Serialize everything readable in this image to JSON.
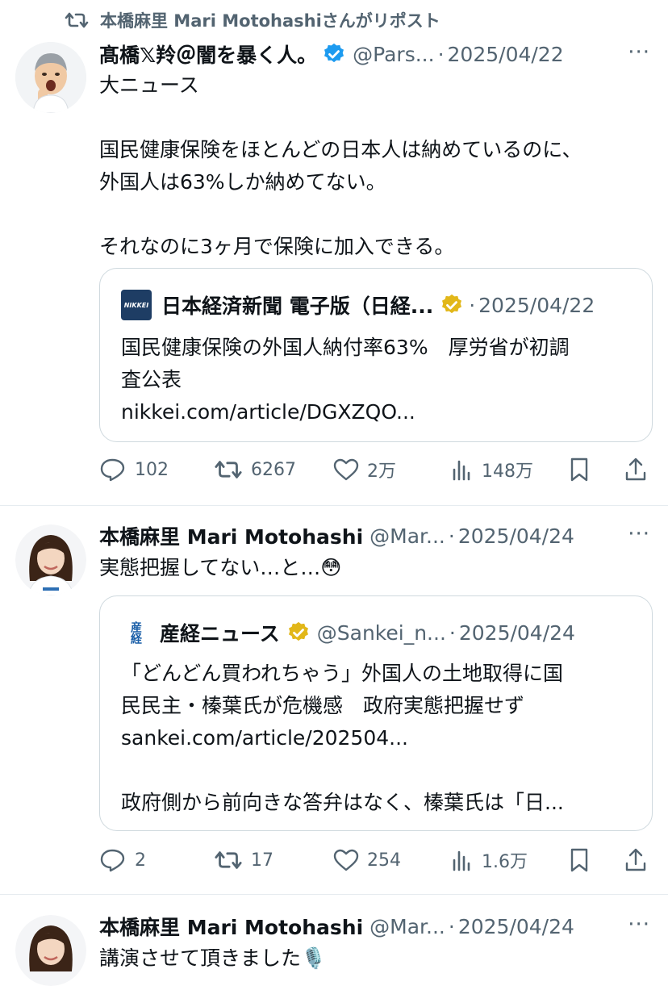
{
  "repost_banner": {
    "text": "本橋麻里 Mari Motohashiさんがリポスト"
  },
  "tweets": [
    {
      "name": "髙橋𝕏羚＠闇を暴く人。",
      "handle": "@Pars...",
      "sep": "·",
      "date": "2025/04/22",
      "more": "···",
      "body": "大ニュース\n\n国民健康保険をほとんどの日本人は納めているのに、\n外国人は63%しか納めてない。\n\nそれなのに3ヶ月で保険に加入できる。",
      "quote": {
        "logo_text": "NIKKEI",
        "name": "日本経済新聞 電子版（日経...",
        "sep": "·",
        "date": "2025/04/22",
        "text": "国民健康保険の外国人納付率63%　厚労省が初調\n査公表\nnikkei.com/article/DGXZQO..."
      },
      "actions": {
        "reply": "102",
        "repost": "6267",
        "like": "2万",
        "views": "148万"
      }
    },
    {
      "name": "本橋麻里 Mari Motohashi",
      "handle": "@Mar...",
      "sep": "·",
      "date": "2025/04/24",
      "more": "···",
      "body": "実態把握してない…と…😳",
      "quote": {
        "logo_text": "産経",
        "name": "産経ニュース",
        "handle": "@Sankei_n...",
        "sep": "·",
        "date": "2025/04/24",
        "text": "「どんどん買われちゃう」外国人の土地取得に国\n民民主・榛葉氏が危機感　政府実態把握せず\nsankei.com/article/202504...\n\n政府側から前向きな答弁はなく、榛葉氏は「日..."
      },
      "actions": {
        "reply": "2",
        "repost": "17",
        "like": "254",
        "views": "1.6万"
      }
    },
    {
      "name": "本橋麻里 Mari Motohashi",
      "handle": "@Mar...",
      "sep": "·",
      "date": "2025/04/24",
      "more": "···",
      "body": "講演させて頂きました🎙️"
    }
  ],
  "colors": {
    "text": "#0f1419",
    "muted": "#536471",
    "verified_blue": "#1d9bf0",
    "verified_gold": "#e2b719",
    "border": "#cfd9de",
    "nikkei_navy": "#1e3d64",
    "sankei_blue": "#1b5fa8"
  },
  "icons": [
    "repost-icon",
    "verified-blue-icon",
    "verified-gold-icon",
    "reply-icon",
    "like-icon",
    "views-icon",
    "bookmark-icon",
    "share-icon",
    "more-icon"
  ]
}
